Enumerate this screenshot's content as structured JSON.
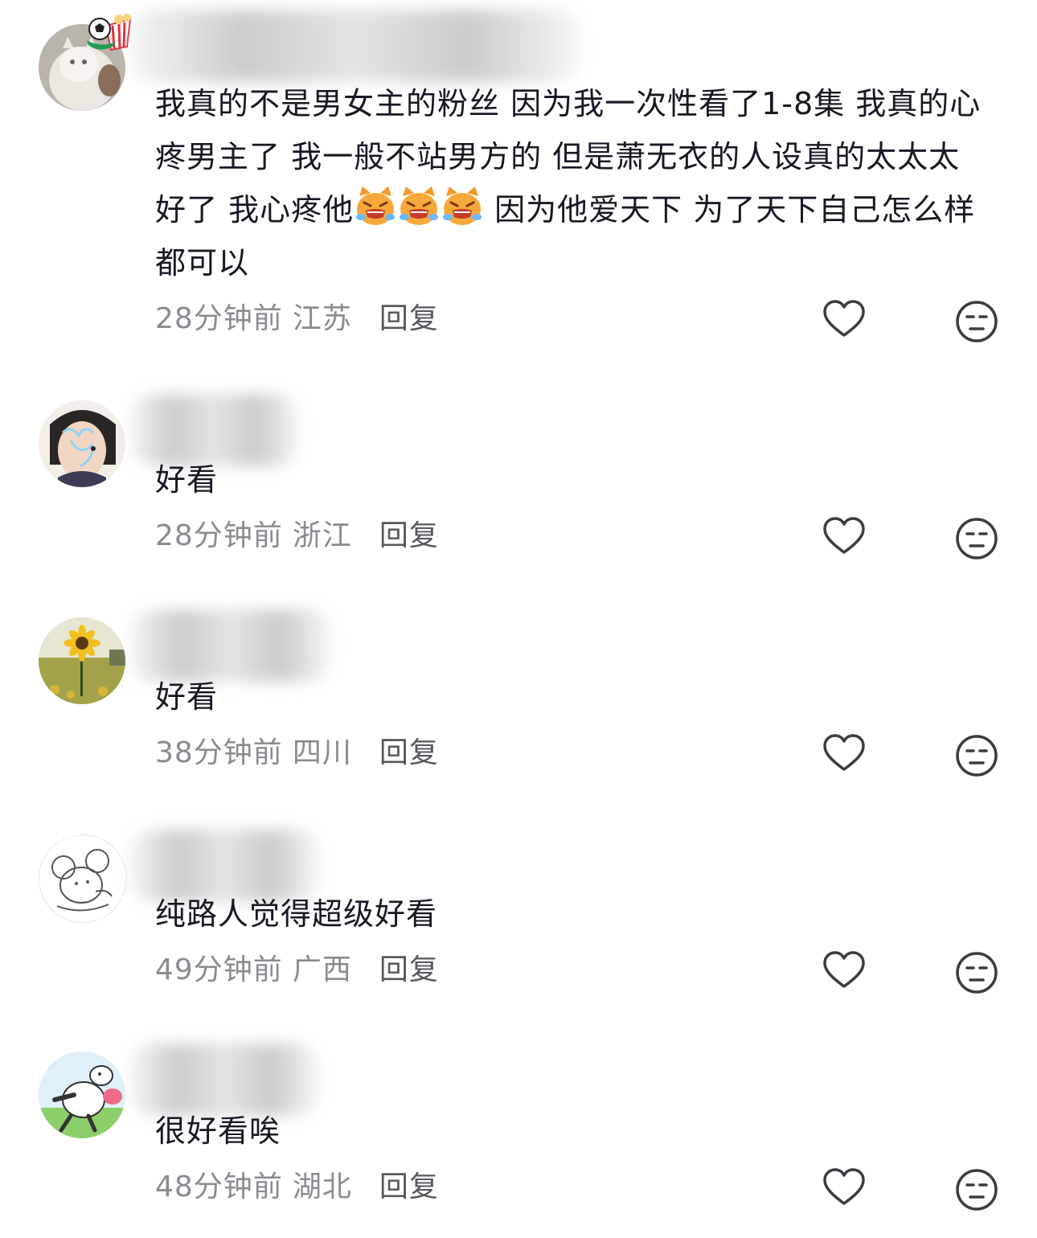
{
  "comments": [
    {
      "avatar": "white-cat-avatar",
      "badge": "soccer-popcorn-badge-icon",
      "text_parts": [
        "我真的不是男女主的粉丝 因为我一次性看了1-8集 我真的心疼男主了 我一般不站男方的 但是萧无衣的人设真的太太太好了 我心疼他",
        " 因为他爱天下 为了天下自己怎么样都可以"
      ],
      "emojis": [
        "crying-cat-icon",
        "crying-cat-icon",
        "crying-cat-icon"
      ],
      "time": "28分钟前",
      "location": "江苏",
      "reply_label": "回复"
    },
    {
      "avatar": "person-portrait-avatar",
      "text": "好看",
      "time": "28分钟前",
      "location": "浙江",
      "reply_label": "回复"
    },
    {
      "avatar": "sunflower-avatar",
      "text": "好看",
      "time": "38分钟前",
      "location": "四川",
      "reply_label": "回复"
    },
    {
      "avatar": "mouse-sketch-avatar",
      "text": "纯路人觉得超级好看",
      "time": "49分钟前",
      "location": "广西",
      "reply_label": "回复"
    },
    {
      "avatar": "cartoon-rabbit-avatar",
      "text": "很好看唉",
      "time": "48分钟前",
      "location": "湖北",
      "reply_label": "回复"
    }
  ],
  "colors": {
    "text": "#161823",
    "meta": "#8a8b91",
    "reply": "#57585e",
    "icon": "#3b3c42"
  }
}
